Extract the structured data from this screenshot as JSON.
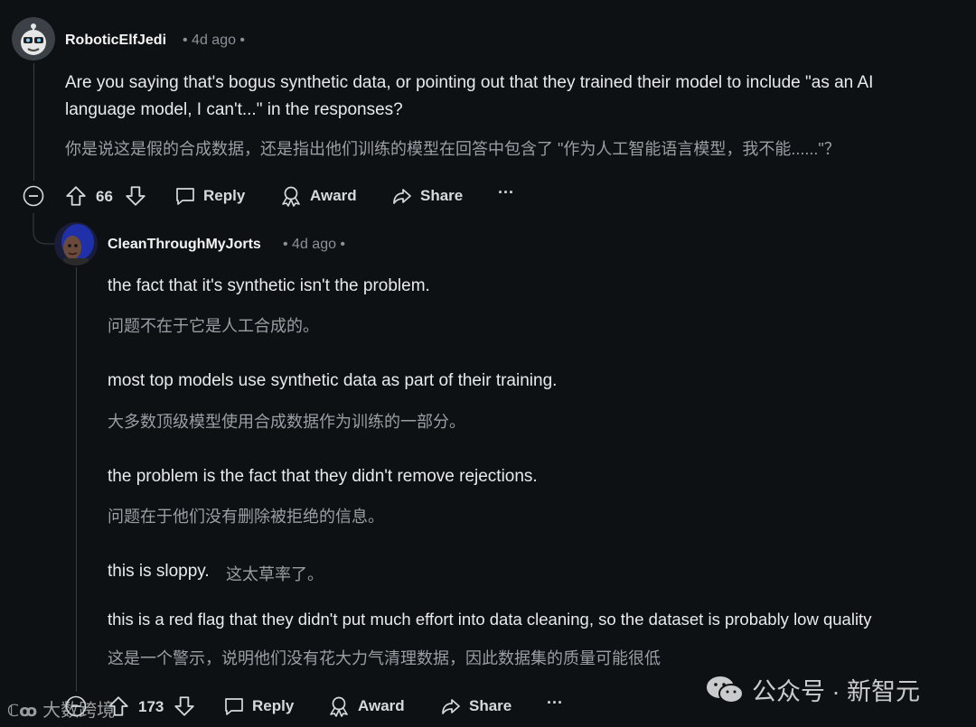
{
  "comment1": {
    "username": "RoboticElfJedi",
    "meta": "• 4d ago •",
    "text_en": "Are you saying that's bogus synthetic data, or pointing out that they trained their model to include \"as an AI language model, I can't...\" in the responses?",
    "text_en_line1": "Are you saying that's bogus synthetic data, or pointing out that they trained their model to include \"as an AI",
    "text_en_line2": "language model, I can't...\" in the responses?",
    "text_zh": "你是说这是假的合成数据，还是指出他们训练的模型在回答中包含了 \"作为人工智能语言模型，我不能......\"？",
    "votes": "66",
    "reply_label": "Reply",
    "award_label": "Award",
    "share_label": "Share",
    "more_label": "···"
  },
  "comment2": {
    "username": "CleanThroughMyJorts",
    "meta": "• 4d ago •",
    "p1_en": "the fact that it's synthetic isn't the problem.",
    "p1_zh": "问题不在于它是人工合成的。",
    "p2_en": "most top models use synthetic data as part of their training.",
    "p2_zh": "大多数顶级模型使用合成数据作为训练的一部分。",
    "p3_en": "the problem is the fact that they didn't remove rejections.",
    "p3_zh": "问题在于他们没有删除被拒绝的信息。",
    "p4_en": "this is sloppy.",
    "p4_zh": "这太草率了。",
    "p5_en": "this is a red flag that they didn't put much effort into data cleaning, so the dataset is probably low quality",
    "p5_zh": "这是一个警示，说明他们没有花大力气清理数据，因此数据集的质量可能很低",
    "votes": "173",
    "reply_label": "Reply",
    "award_label": "Award",
    "share_label": "Share",
    "more_label": "···"
  },
  "watermarks": {
    "left": "大数跨境",
    "right": "公众号 · 新智元"
  },
  "icons": [
    "collapse-icon",
    "upvote-icon",
    "downvote-icon",
    "comment-icon",
    "award-icon",
    "share-icon",
    "more-icon",
    "wechat-icon"
  ],
  "colors": {
    "background": "#0e1113",
    "text": "#e8eaec",
    "muted": "#9a9fa3",
    "line": "#3a3d3f"
  }
}
